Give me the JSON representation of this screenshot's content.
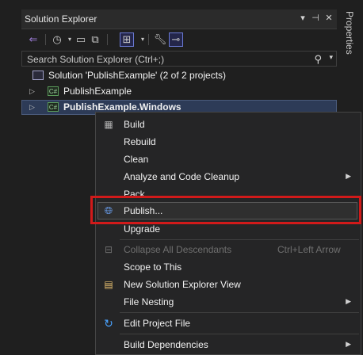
{
  "panel": {
    "title": "Solution Explorer",
    "title_buttons": [
      "▾",
      "⊣",
      "✕"
    ]
  },
  "search": {
    "placeholder": "Search Solution Explorer (Ctrl+;)"
  },
  "tree": {
    "solution": "Solution 'PublishExample' (2 of 2 projects)",
    "projects": [
      {
        "name": "PublishExample",
        "badge": "C#"
      },
      {
        "name": "PublishExample.Windows",
        "badge": "C#"
      }
    ]
  },
  "side_tab": {
    "label": "Properties"
  },
  "menu": {
    "items": [
      {
        "label": "Build"
      },
      {
        "label": "Rebuild"
      },
      {
        "label": "Clean"
      },
      {
        "label": "Analyze and Code Cleanup"
      },
      {
        "label": "Pack"
      },
      {
        "label": "Publish..."
      },
      {
        "label": "Upgrade"
      },
      {
        "label": "Collapse All Descendants",
        "shortcut": "Ctrl+Left Arrow"
      },
      {
        "label": "Scope to This"
      },
      {
        "label": "New Solution Explorer View"
      },
      {
        "label": "File Nesting"
      },
      {
        "label": "Edit Project File"
      },
      {
        "label": "Build Dependencies"
      }
    ]
  },
  "colors": {
    "highlight_box": "#d11a1a",
    "selection": "#2d3b57",
    "background": "#1f1f1f"
  }
}
